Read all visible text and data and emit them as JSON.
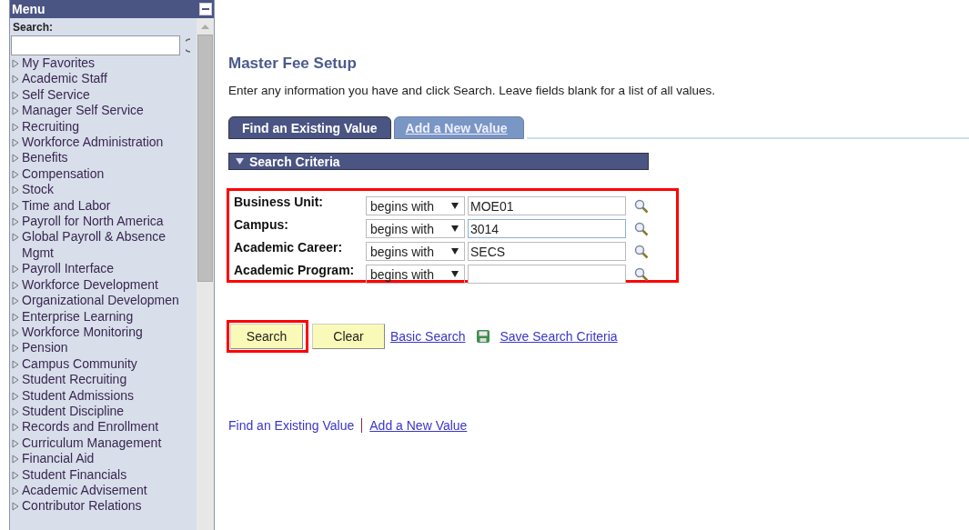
{
  "menu": {
    "title": "Menu",
    "search_label": "Search:",
    "items": [
      {
        "label": "My Favorites"
      },
      {
        "label": "Academic Staff"
      },
      {
        "label": "Self Service"
      },
      {
        "label": "Manager Self Service"
      },
      {
        "label": "Recruiting"
      },
      {
        "label": "Workforce Administration"
      },
      {
        "label": "Benefits"
      },
      {
        "label": "Compensation"
      },
      {
        "label": "Stock"
      },
      {
        "label": "Time and Labor"
      },
      {
        "label": "Payroll for North America"
      },
      {
        "label": "Global Payroll & Absence Mgmt"
      },
      {
        "label": "Payroll Interface"
      },
      {
        "label": "Workforce Development"
      },
      {
        "label": "Organizational Developmen"
      },
      {
        "label": "Enterprise Learning"
      },
      {
        "label": "Workforce Monitoring"
      },
      {
        "label": "Pension"
      },
      {
        "label": "Campus Community"
      },
      {
        "label": "Student Recruiting"
      },
      {
        "label": "Student Admissions"
      },
      {
        "label": "Student Discipline"
      },
      {
        "label": "Records and Enrollment"
      },
      {
        "label": "Curriculum Management"
      },
      {
        "label": "Financial Aid"
      },
      {
        "label": "Student Financials"
      },
      {
        "label": "Academic Advisement"
      },
      {
        "label": "Contributor Relations"
      }
    ]
  },
  "page": {
    "title": "Master Fee Setup",
    "instructions": "Enter any information you have and click Search. Leave fields blank for a list of all values."
  },
  "tabs": [
    {
      "label": "Find an Existing Value",
      "selected": true
    },
    {
      "label": "Add a New Value",
      "selected": false
    }
  ],
  "section": {
    "title": "Search Criteria",
    "expanded": true
  },
  "fields": [
    {
      "label": "Business Unit:",
      "operator": "begins with",
      "value": "MOE01",
      "focused": false
    },
    {
      "label": "Campus:",
      "operator": "begins with",
      "value": "3014",
      "focused": true
    },
    {
      "label": "Academic Career:",
      "operator": "begins with",
      "value": "SECS",
      "focused": false
    },
    {
      "label": "Academic Program:",
      "operator": "begins with",
      "focused": false
    }
  ],
  "buttons": [
    {
      "label": "Search",
      "highlighted": true
    },
    {
      "label": "Clear",
      "highlighted": false
    }
  ],
  "links": [
    {
      "label": "Basic Search",
      "kind": "plain"
    },
    {
      "label": "Save Search Criteria",
      "kind": "save"
    }
  ],
  "footer_links": [
    {
      "label": "Find an Existing Value",
      "underlined": false
    },
    {
      "label": "Add a New Value",
      "underlined": true
    }
  ]
}
